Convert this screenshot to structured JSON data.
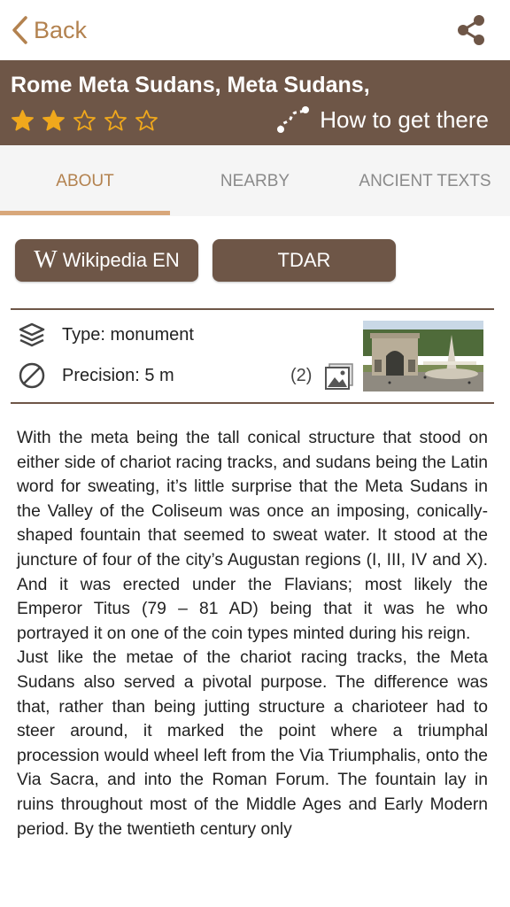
{
  "nav": {
    "back_label": "Back"
  },
  "header": {
    "title": "Rome Meta Sudans, Meta Sudans,",
    "rating": 2,
    "rating_max": 5,
    "how_to_label": "How to get there"
  },
  "tabs": [
    {
      "label": "ABOUT",
      "active": true
    },
    {
      "label": "NEARBY",
      "active": false
    },
    {
      "label": "ANCIENT TEXTS",
      "active": false
    }
  ],
  "links": {
    "wikipedia_label": "Wikipedia EN",
    "tdar_label": "TDAR"
  },
  "info": {
    "type_label": "Type: monument",
    "precision_label": "Precision: 5 m",
    "photo_count": "(2)"
  },
  "description": [
    "With the meta being the tall conical structure that stood on either side of chariot racing tracks, and sudans being the Latin word for sweating, it’s little surprise that the Meta Sudans in the Valley of the Coliseum was once an imposing, conically-shaped fountain that seemed to sweat water. It stood at the juncture of four of the city’s Augustan regions (I, III, IV and X). And it was erected under the Flavians; most likely the Emperor Titus (79 – 81 AD) being that it was he who portrayed it on one of the coin types minted during his reign.",
    "Just like the metae of the chariot racing tracks, the Meta Sudans also served a pivotal purpose. The difference was that, rather than being jutting structure a charioteer had to steer around, it marked the point where a triumphal procession would wheel left from the Via Triumphalis, onto the Via Sacra, and into the Roman Forum. The fountain lay in ruins throughout most of the Middle Ages and Early Modern period. By the twentieth century only"
  ],
  "colors": {
    "accent": "#b3824f",
    "brand_brown": "#6e5647",
    "star": "#f0a81c",
    "tab_bg": "#f5f5f5"
  }
}
